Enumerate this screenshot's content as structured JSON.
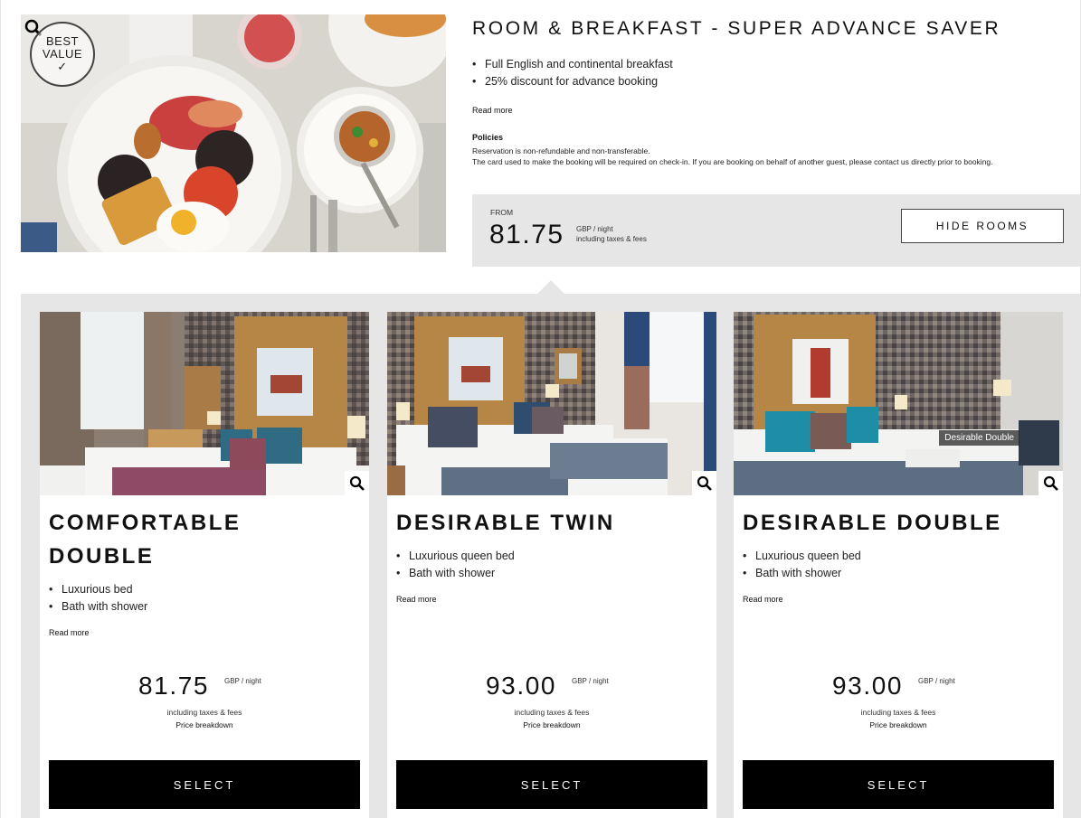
{
  "offer": {
    "badge_line1": "BEST",
    "badge_line2": "VALUE",
    "badge_check": "✓",
    "title": "ROOM & BREAKFAST - SUPER ADVANCE SAVER",
    "bullets": [
      "Full English and continental breakfast",
      "25% discount for advance booking"
    ],
    "read_more": "Read more",
    "policies_title": "Policies",
    "policies_line1": "Reservation is non-refundable and non-transferable.",
    "policies_line2": "The card used to make the booking will be required on check-in. If you are booking on behalf of another guest, please contact us directly prior to booking.",
    "from_label": "FROM",
    "price": "81.75",
    "price_unit": "GBP / night",
    "price_incl": "including taxes & fees",
    "hide_rooms_label": "HIDE ROOMS"
  },
  "rooms": [
    {
      "title": "COMFORTABLE DOUBLE",
      "features": [
        "Luxurious bed",
        "Bath with shower"
      ],
      "read_more": "Read more",
      "price": "81.75",
      "unit": "GBP / night",
      "incl": "including taxes & fees",
      "breakdown": "Price breakdown",
      "select_label": "SELECT"
    },
    {
      "title": "DESIRABLE TWIN",
      "features": [
        "Luxurious queen bed",
        "Bath with shower"
      ],
      "read_more": "Read more",
      "price": "93.00",
      "unit": "GBP / night",
      "incl": "including taxes & fees",
      "breakdown": "Price breakdown",
      "select_label": "SELECT"
    },
    {
      "title": "DESIRABLE DOUBLE",
      "photo_tag": "Desirable Double",
      "features": [
        "Luxurious queen bed",
        "Bath with shower"
      ],
      "read_more": "Read more",
      "price": "93.00",
      "unit": "GBP / night",
      "incl": "including taxes & fees",
      "breakdown": "Price breakdown",
      "select_label": "SELECT"
    }
  ],
  "icons": {
    "zoom": "magnifier-icon"
  }
}
